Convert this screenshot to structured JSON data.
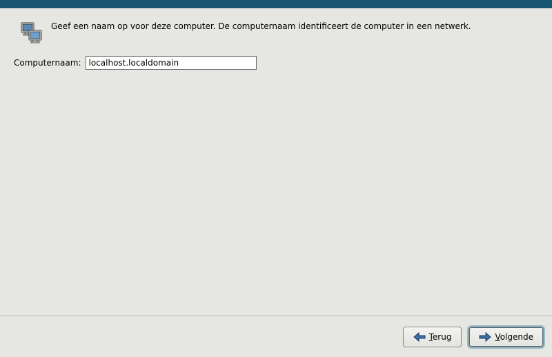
{
  "intro": {
    "text": "Geef een naam op voor deze computer. De computernaam identificeert de computer in een netwerk."
  },
  "form": {
    "hostname_label": "Computernaam:",
    "hostname_value": "localhost.localdomain"
  },
  "buttons": {
    "back_hotkey": "T",
    "back_rest": "erug",
    "next_hotkey": "V",
    "next_rest": "olgende"
  }
}
